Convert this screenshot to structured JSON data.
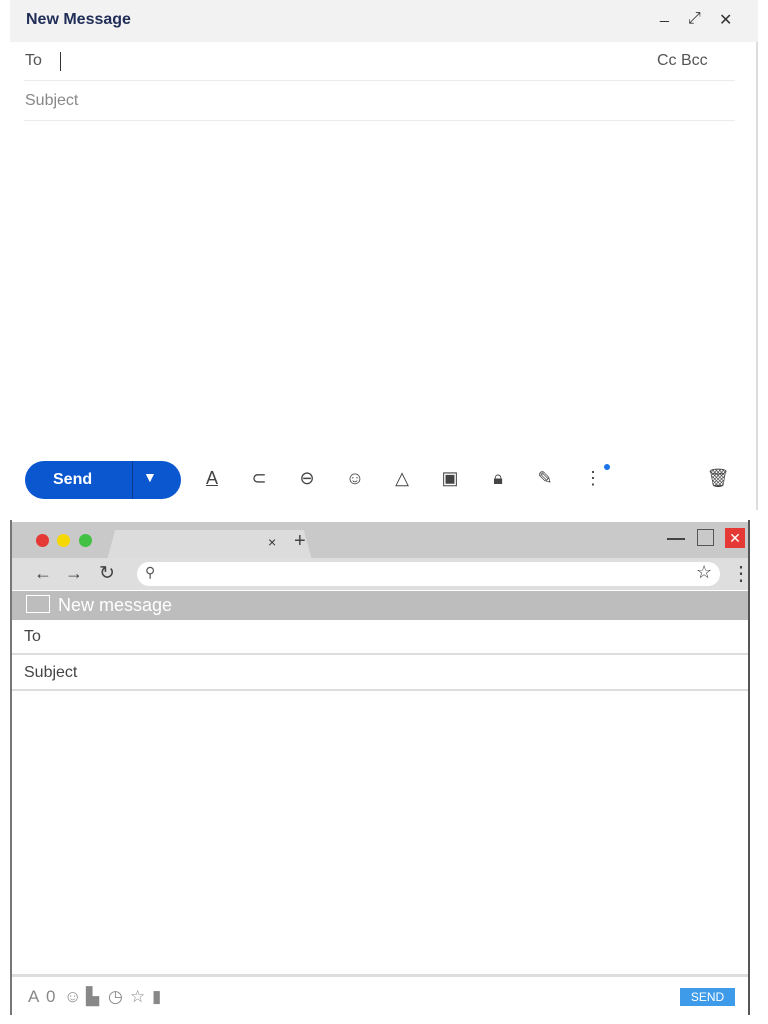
{
  "gmail_compose": {
    "title": "New Message",
    "window_icons": [
      "minimize-icon",
      "expand-icon",
      "close-icon"
    ],
    "to_label": "To",
    "cc_bcc": "Cc Bcc",
    "subject_placeholder": "Subject",
    "send_label": "Send",
    "toolbar_icons": [
      "formatting-icon",
      "attach-icon",
      "link-icon",
      "emoji-icon",
      "drive-icon",
      "photo-icon",
      "confidential-icon",
      "signature-icon",
      "more-options-icon",
      "trash-icon"
    ],
    "accent": "#0b57d0"
  },
  "browser_compose": {
    "tab_close": "×",
    "new_tab": "+",
    "header_title": "New message",
    "to_label": "To",
    "subject_label": "Subject",
    "send_label": "SEND",
    "close_color": "#e53935",
    "send_color": "#3d9be9"
  }
}
